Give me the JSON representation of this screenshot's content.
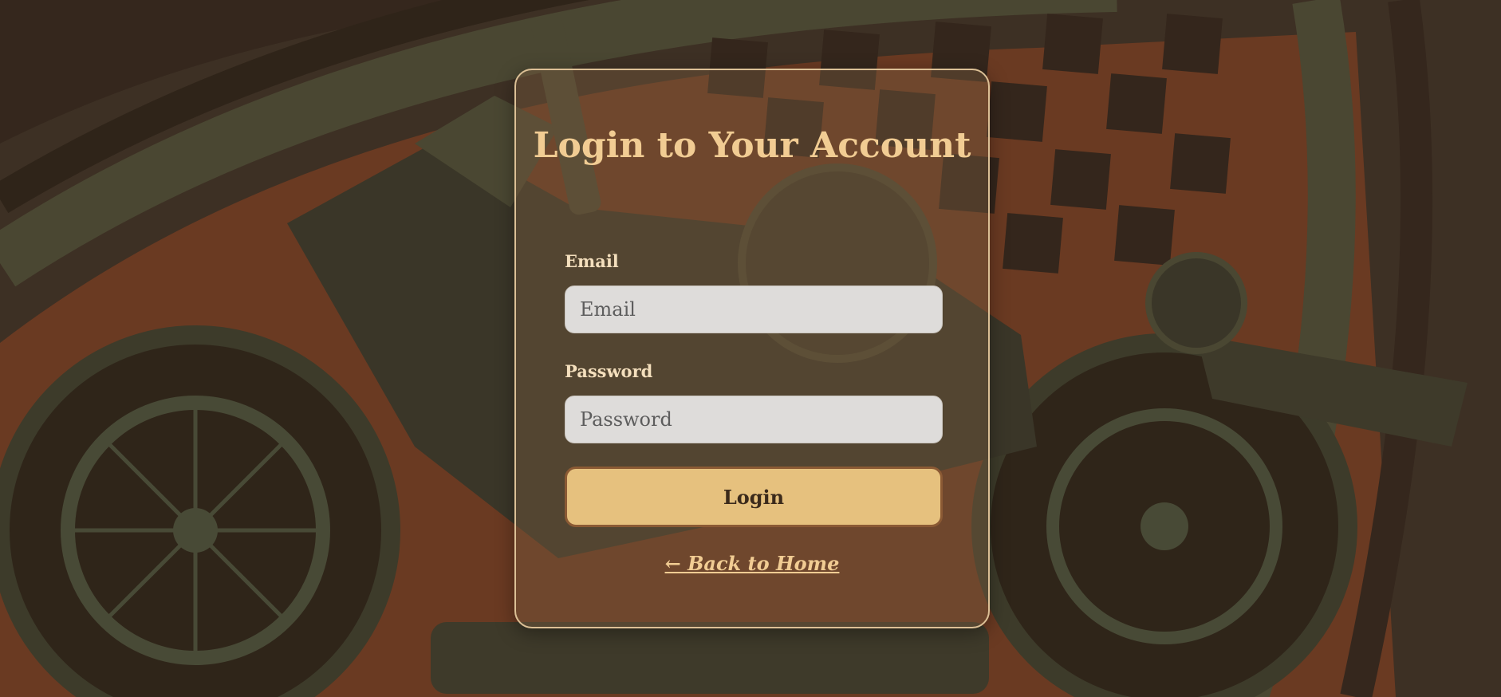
{
  "colors": {
    "background": "#35271d",
    "accent_orange": "#6a3a22",
    "card_border": "#dcc096",
    "title": "#f1cc93",
    "button_fill": "#e6c17e",
    "button_border": "#8b5a34",
    "input_fill": "#dedcda"
  },
  "background": {
    "icon": "motorcycle-racing-flag-illustration"
  },
  "login": {
    "title": "Login to Your Account",
    "email_label": "Email",
    "email_placeholder": "Email",
    "email_value": "",
    "password_label": "Password",
    "password_placeholder": "Password",
    "password_value": "",
    "submit_label": "Login",
    "back_link": "← Back to Home"
  }
}
